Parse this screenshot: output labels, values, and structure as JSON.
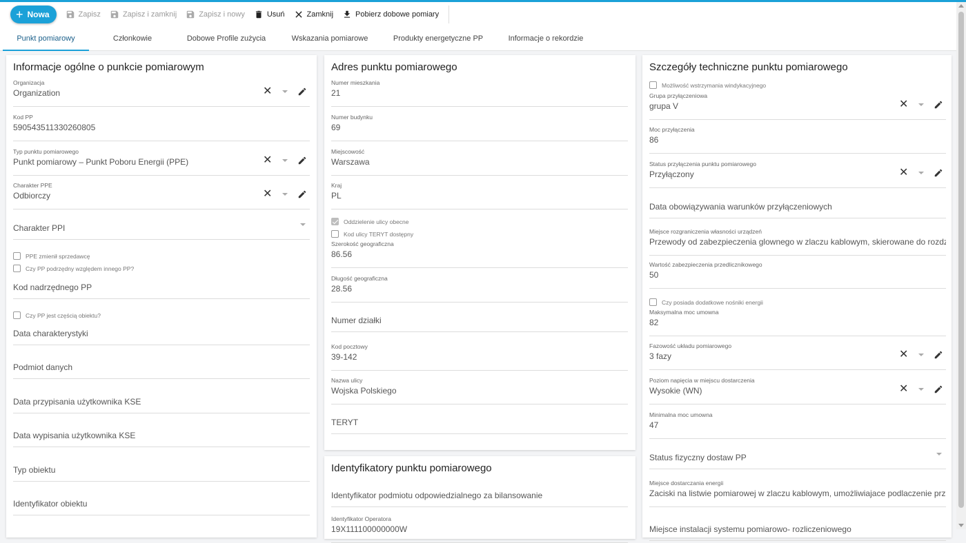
{
  "toolbar": {
    "new_label": "Nowa",
    "save_label": "Zapisz",
    "save_close_label": "Zapisz i zamknij",
    "save_new_label": "Zapisz i nowy",
    "delete_label": "Usuń",
    "close_label": "Zamknij",
    "download_label": "Pobierz dobowe pomiary"
  },
  "tabs": [
    {
      "label": "Punkt pomiarowy",
      "active": true
    },
    {
      "label": "Członkowie"
    },
    {
      "label": "Dobowe Profile zużycia"
    },
    {
      "label": "Wskazania pomiarowe"
    },
    {
      "label": "Produkty energetyczne PP"
    },
    {
      "label": "Informacje o rekordzie"
    }
  ],
  "general": {
    "title": "Informacje ogólne o punkcie pomiarowym",
    "organization": {
      "label": "Organizacja",
      "value": "Organization"
    },
    "kod_pp": {
      "label": "Kod PP",
      "value": "590543511330260805"
    },
    "typ_punktu": {
      "label": "Typ punktu pomiarowego",
      "value": "Punkt pomiarowy – Punkt Poboru Energii (PPE)"
    },
    "charakter_ppe": {
      "label": "Charakter PPE",
      "value": "Odbiorczy"
    },
    "charakter_ppi": {
      "placeholder": "Charakter PPI"
    },
    "cb_ppe_zmienil": "PPE zmienił sprzedawcę",
    "cb_podrzedny": "Czy PP podrzędny względem innego PP?",
    "kod_nadrzednego": {
      "placeholder": "Kod nadrzędnego PP"
    },
    "cb_czesc_obiektu": "Czy PP jest częścią obiektu?",
    "data_charakterystyki": {
      "placeholder": "Data charakterystyki"
    },
    "podmiot_danych": {
      "placeholder": "Podmiot danych"
    },
    "data_przypisania": {
      "placeholder": "Data przypisania użytkownika KSE"
    },
    "data_wypisania": {
      "placeholder": "Data wypisania użytkownika KSE"
    },
    "typ_obiektu": {
      "placeholder": "Typ obiektu"
    },
    "identyfikator_obiektu": {
      "placeholder": "Identyfikator obiektu"
    }
  },
  "address": {
    "title": "Adres punktu pomiarowego",
    "numer_mieszkania": {
      "label": "Numer mieszkania",
      "value": "21"
    },
    "numer_budynku": {
      "label": "Numer budynku",
      "value": "69"
    },
    "miejscowosc": {
      "label": "Miejscowość",
      "value": "Warszawa"
    },
    "kraj": {
      "label": "Kraj",
      "value": "PL"
    },
    "cb_oddzielenie": "Oddzielenie ulicy obecne",
    "cb_kod_ulicy": "Kod ulicy TERYT dostępny",
    "szerokosc": {
      "label": "Szerokość geograficzna",
      "value": "86.56"
    },
    "dlugosc": {
      "label": "Długość geograficzna",
      "value": "28.56"
    },
    "numer_dzialki": {
      "placeholder": "Numer działki"
    },
    "kod_pocztowy": {
      "label": "Kod pocztowy",
      "value": "39-142"
    },
    "nazwa_ulicy": {
      "label": "Nazwa ulicy",
      "value": "Wojska Polskiego"
    },
    "teryt": {
      "placeholder": "TERYT"
    }
  },
  "identifiers": {
    "title": "Identyfikatory punktu pomiarowego",
    "podmiot_bilansowanie": {
      "placeholder": "Identyfikator podmiotu odpowiedzialnego za bilansowanie"
    },
    "operator": {
      "label": "Identyfikator Operatora",
      "value": "19X111100000000W"
    }
  },
  "technical": {
    "title": "Szczegóły techniczne punktu pomiarowego",
    "cb_wstrzymania": "Możliwość wstrzymania windykacyjnego",
    "grupa": {
      "label": "Grupa przyłączeniowa",
      "value": "grupa V"
    },
    "moc": {
      "label": "Moc przyłączenia",
      "value": "86"
    },
    "status": {
      "label": "Status przyłączenia punktu pomiarowego",
      "value": "Przyłączony"
    },
    "data_obowiazywania": {
      "placeholder": "Data obowiązywania warunków przyłączeniowych"
    },
    "miejsce_rozgraniczenia": {
      "label": "Miejsce rozgraniczenia własności urządzeń",
      "value": "Przewody od zabezpieczenia glownego w zlaczu kablowym, skierowane do rozdzielnicy"
    },
    "wartosc_zabezpieczenia": {
      "label": "Wartość zabezpieczenia przedlicznikowego",
      "value": "50"
    },
    "cb_nosniki": "Czy posiada dodatkowe nośniki energii",
    "maksymalna_moc": {
      "label": "Maksymalna moc umowna",
      "value": "82"
    },
    "fazowosc": {
      "label": "Fazowość układu pomiarowego",
      "value": "3 fazy"
    },
    "poziom_napiecia": {
      "label": "Poziom napięcia w miejscu dostarczenia",
      "value": "Wysokie (WN)"
    },
    "minimalna_moc": {
      "label": "Minimalna moc umowna",
      "value": "47"
    },
    "status_fizyczny": {
      "placeholder": "Status fizyczny dostaw PP"
    },
    "miejsce_dostarczania": {
      "label": "Miejsce dostarczania energii",
      "value": "Zaciski na listwie pomiarowej w zlaczu kablowym, umożliwiajace podlaczenie przewodow"
    },
    "miejsce_instalacji": {
      "placeholder": "Miejsce instalacji systemu pomiarowo- rozliczeniowego"
    }
  },
  "colors": {
    "accent": "#1ba1d8",
    "tab_active_text": "#1a5f8a"
  }
}
